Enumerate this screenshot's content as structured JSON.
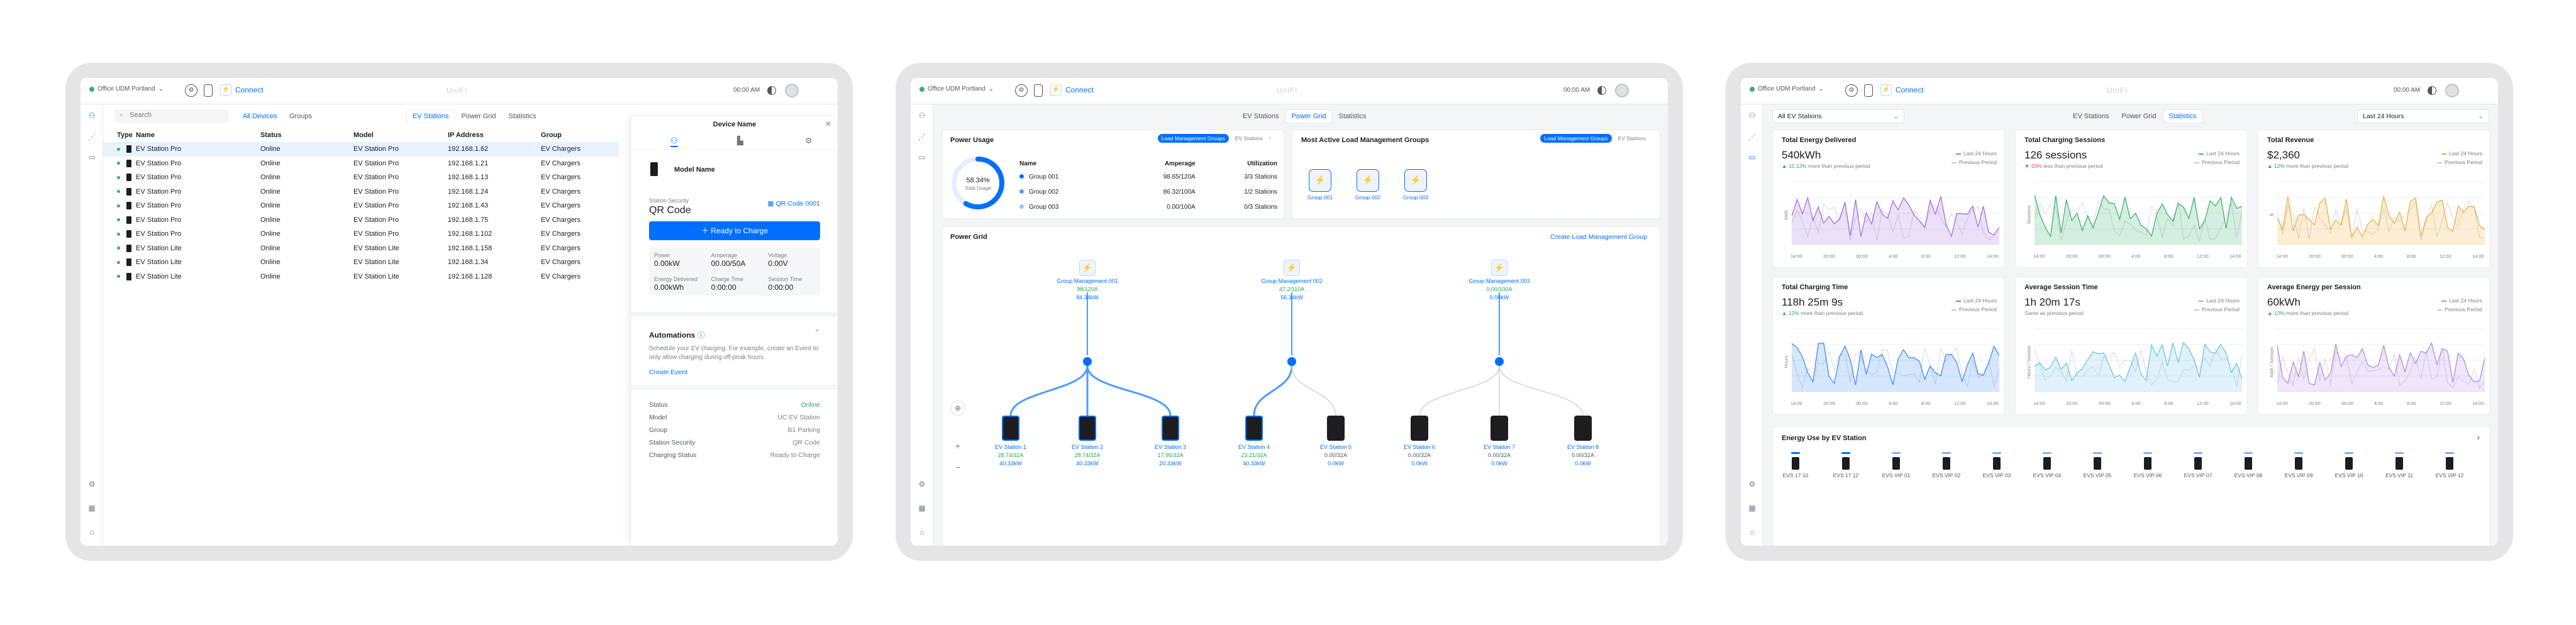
{
  "common": {
    "console": "Office UDM Portland",
    "app": "Connect",
    "logo": "UniFi",
    "time": "00:00 AM",
    "tabs": [
      "EV Stations",
      "Power Grid",
      "Statistics"
    ]
  },
  "p1": {
    "search_placeholder": "Search",
    "filters": [
      "All Devices",
      "Groups"
    ],
    "columns": [
      "Type",
      "Name",
      "Status",
      "Model",
      "IP Address",
      "Group"
    ],
    "rows": [
      [
        "EV Station Pro",
        "Online",
        "EV Station Pro",
        "192.168.1.62",
        "EV Chargers"
      ],
      [
        "EV Station Pro",
        "Online",
        "EV Station Pro",
        "192.168.1.21",
        "EV Chargers"
      ],
      [
        "EV Station Pro",
        "Online",
        "EV Station Pro",
        "192.168.1.13",
        "EV Chargers"
      ],
      [
        "EV Station Pro",
        "Online",
        "EV Station Pro",
        "192.168.1.24",
        "EV Chargers"
      ],
      [
        "EV Station Pro",
        "Online",
        "EV Station Pro",
        "192.168.1.43",
        "EV Chargers"
      ],
      [
        "EV Station Pro",
        "Online",
        "EV Station Pro",
        "192.168.1.75",
        "EV Chargers"
      ],
      [
        "EV Station Pro",
        "Online",
        "EV Station Pro",
        "192.168.1.102",
        "EV Chargers"
      ],
      [
        "EV Station Lite",
        "Online",
        "EV Station Lite",
        "192.168.1.158",
        "EV Chargers"
      ],
      [
        "EV Station Lite",
        "Online",
        "EV Station Lite",
        "192.168.1.34",
        "EV Chargers"
      ],
      [
        "EV Station Lite",
        "Online",
        "EV Station Lite",
        "192.168.1.128",
        "EV Chargers"
      ]
    ],
    "panel": {
      "title": "Device Name",
      "model": "Model Name",
      "security_label": "Station Security",
      "security_value": "QR Code",
      "qr_link": "QR-Code 0001",
      "ready_button": "Ready to Charge",
      "stats": [
        [
          "Power",
          "0.00kW"
        ],
        [
          "Amperage",
          "00.00/50A"
        ],
        [
          "Voltage",
          "0.00V"
        ],
        [
          "Energy Delivered",
          "0.00kWh"
        ],
        [
          "Charge Time",
          "0:00:00"
        ],
        [
          "Session Time",
          "0:00:00"
        ]
      ],
      "automations_title": "Automations",
      "automations_desc": "Schedule your EV charging. For example, create an Event to only allow charging during off-peak hours.",
      "create_event": "Create Event",
      "details": [
        [
          "Status",
          "Online"
        ],
        [
          "Model",
          "UC EV Station"
        ],
        [
          "Group",
          "B1 Parking"
        ],
        [
          "Station Security",
          "QR Code"
        ],
        [
          "Charging Status",
          "Ready to Charge"
        ]
      ]
    }
  },
  "p2": {
    "power_usage": {
      "title": "Power Usage",
      "toggle": [
        "Load Management Groups",
        "EV Stations"
      ],
      "percent": "58.34%",
      "percent_value": 58.34,
      "gauge_label": "Total Usage",
      "columns": [
        "Name",
        "Amperage",
        "Utilization"
      ],
      "rows": [
        [
          "Group 001",
          "98.65/120A",
          "3/3 Stations"
        ],
        [
          "Group 002",
          "86.32/100A",
          "1/2 Stations"
        ],
        [
          "Group 003",
          "0.00/100A",
          "0/3 Stations"
        ]
      ],
      "dot_colors": [
        "#006fff",
        "#4d9bff",
        "#99c5ff"
      ]
    },
    "active": {
      "title": "Most Active Load Management Groups",
      "toggle": [
        "Load Management Groups",
        "EV Stations"
      ],
      "groups": [
        "Group 001",
        "Group 002",
        "Group 003"
      ]
    },
    "grid": {
      "title": "Power Grid",
      "create": "Create Load Management Group",
      "groups": [
        {
          "name": "Group Management 001",
          "amp": "98/120A",
          "kw": "84.34kW"
        },
        {
          "name": "Group Management 002",
          "amp": "47.2/110A",
          "kw": "56.34kW"
        },
        {
          "name": "Group Management 003",
          "amp": "0.00/100A",
          "kw": "0.00kW"
        }
      ],
      "stations": [
        {
          "name": "EV Station 1",
          "amp": "28.74/32A",
          "kw": "40.33kW"
        },
        {
          "name": "EV Station 2",
          "amp": "28.74/32A",
          "kw": "40.33kW"
        },
        {
          "name": "EV Station 3",
          "amp": "17.95/32A",
          "kw": "20.33kW"
        },
        {
          "name": "EV Station 4",
          "amp": "23.21/32A",
          "kw": "40.33kW"
        },
        {
          "name": "EV Station 5",
          "amp": "0.00/32A",
          "kw": "0.0kW"
        },
        {
          "name": "EV Station 6",
          "amp": "0.00/32A",
          "kw": "0.0kW"
        },
        {
          "name": "EV Station 7",
          "amp": "0.00/32A",
          "kw": "0.0kW"
        },
        {
          "name": "EV Station 8",
          "amp": "0.00/32A",
          "kw": "0.0kW"
        }
      ]
    }
  },
  "p3": {
    "filter": "All EV Stations",
    "range": "Last 24 Hours",
    "cards": [
      {
        "title": "Total Energy Delivered",
        "value": "540kWh",
        "change": "10.12%",
        "change_text": "more than previous period",
        "up": true,
        "ylabel": "kWh",
        "color": "#a070e0"
      },
      {
        "title": "Total Charging Sessions",
        "value": "126 sessions",
        "change": "20%",
        "change_text": "less than previous period",
        "up": false,
        "ylabel": "Sessions",
        "color": "#3cb371"
      },
      {
        "title": "Total Revenue",
        "value": "$2,360",
        "change": "12%",
        "change_text": "more than previous period",
        "up": true,
        "ylabel": "$",
        "color": "#f0b040"
      },
      {
        "title": "Total Charging Time",
        "value": "118h 25m 9s",
        "change": "12%",
        "change_text": "more than previous period",
        "up": true,
        "ylabel": "Hours",
        "color": "#3f8bff"
      },
      {
        "title": "Average Session Time",
        "value": "1h 20m 17s",
        "change": "",
        "change_text": "Same as previous period",
        "up": true,
        "ylabel": "Hours / Session",
        "color": "#6ec3e8"
      },
      {
        "title": "Average Energy per Session",
        "value": "60kWh",
        "change": "12%",
        "change_text": "more than previous period",
        "up": true,
        "ylabel": "kWh / Session",
        "color": "#b18be8"
      }
    ],
    "legend": [
      "Last 24 Hours",
      "Previous Period"
    ],
    "xticks": [
      "14:00",
      "20:00",
      "00:00",
      "4:00",
      "8:00",
      "12:00",
      "14:00"
    ],
    "energy_title": "Energy Use by EV Station",
    "energy_stations": [
      "EVS 17 10",
      "EVS 17 12",
      "EVS VIP 01",
      "EVS VIP 02",
      "EVS VIP 03",
      "EVS VIP 04",
      "EVS VIP 05",
      "EVS VIP 06",
      "EVS VIP 07",
      "EVS VIP 08",
      "EVS VIP 09",
      "EVS VIP 10",
      "EVS VIP 11",
      "EVS VIP 12"
    ]
  }
}
